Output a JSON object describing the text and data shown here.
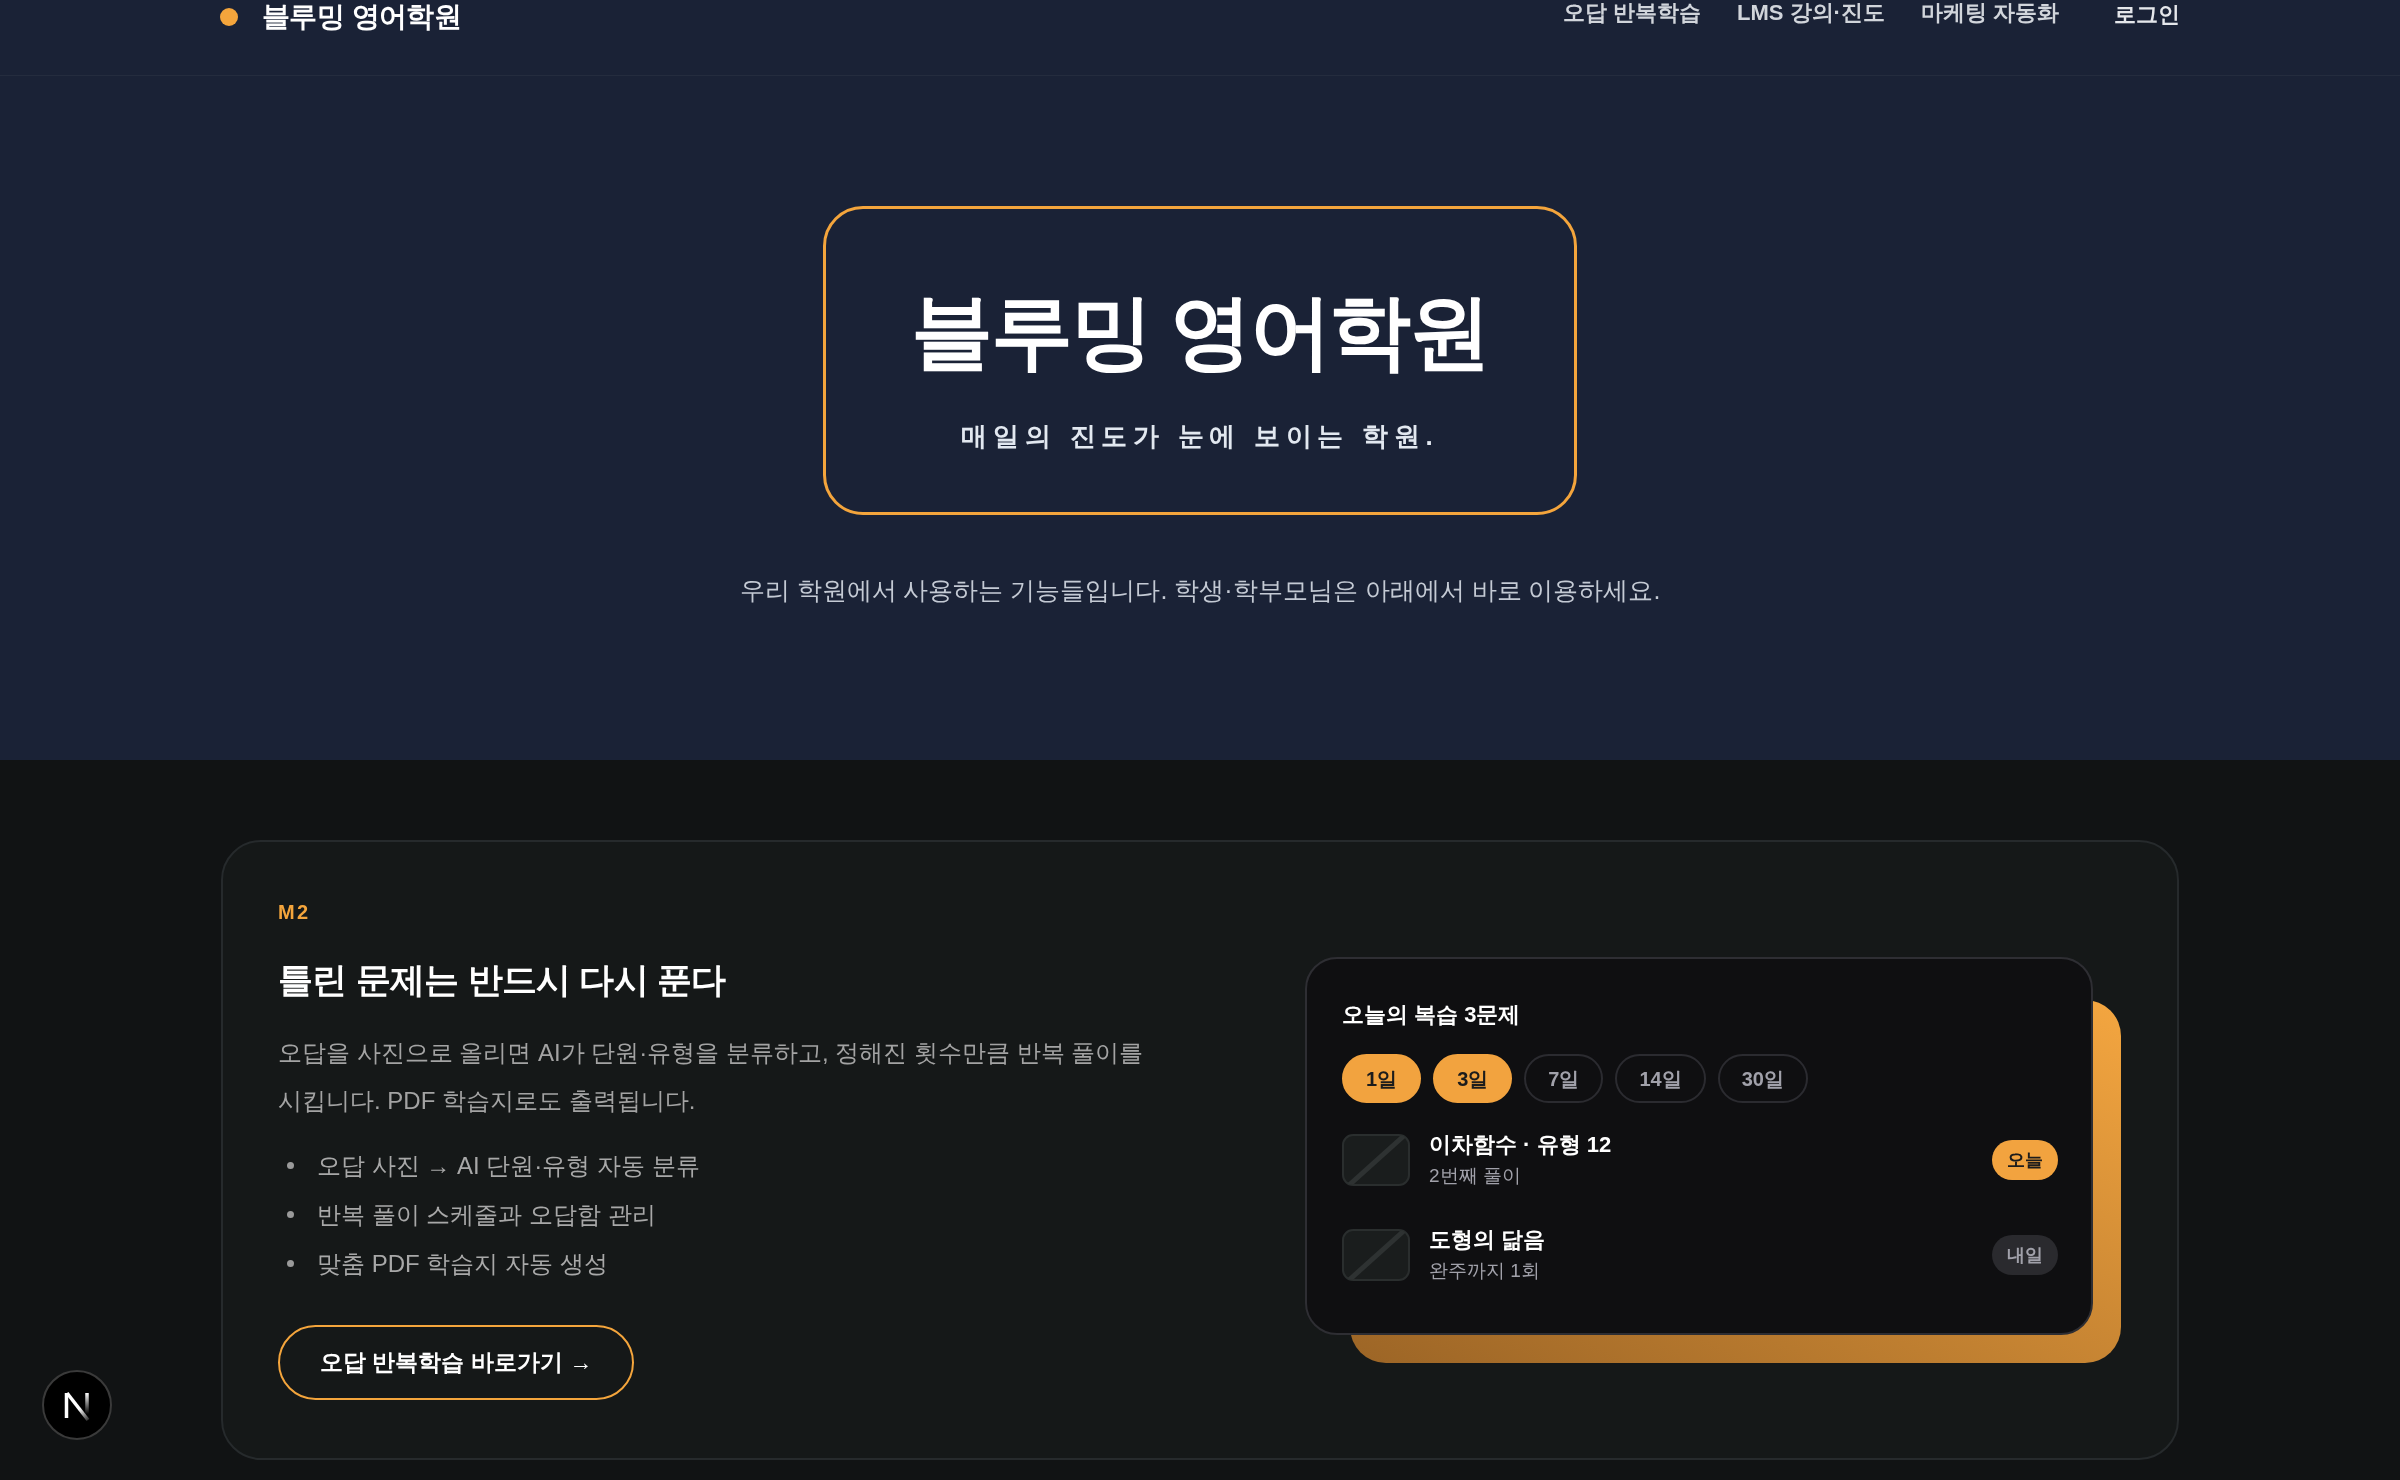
{
  "header": {
    "logo": "블루밍 영어학원",
    "nav": [
      "오답 반복학습",
      "LMS 강의·진도",
      "마케팅 자동화"
    ],
    "login": "로그인"
  },
  "hero": {
    "title": "블루밍 영어학원",
    "tagline": "매일의 진도가 눈에 보이는 학원.",
    "description": "우리 학원에서 사용하는 기능들입니다. 학생·학부모님은 아래에서 바로 이용하세요."
  },
  "feature": {
    "tag": "M2",
    "title": "틀린 문제는 반드시 다시 푼다",
    "description": "오답을 사진으로 올리면 AI가 단원·유형을 분류하고, 정해진 횟수만큼 반복 풀이를 시킵니다. PDF 학습지로도 출력됩니다.",
    "bullets": [
      "오답 사진 → AI 단원·유형 자동 분류",
      "반복 풀이 스케줄과 오답함 관리",
      "맞춤 PDF 학습지 자동 생성"
    ],
    "button": "오답 반복학습 바로가기 →",
    "review_card": {
      "title": "오늘의 복습 3문제",
      "intervals": [
        {
          "label": "1일",
          "selected": true
        },
        {
          "label": "3일",
          "selected": true
        },
        {
          "label": "7일",
          "selected": false
        },
        {
          "label": "14일",
          "selected": false
        },
        {
          "label": "30일",
          "selected": false
        }
      ],
      "items": [
        {
          "title": "이차함수 · 유형 12",
          "subtitle": "2번째 풀이",
          "badge": {
            "label": "오늘",
            "highlighted": true
          }
        },
        {
          "title": "도형의 닮음",
          "subtitle": "완주까지 1회",
          "badge": {
            "label": "내일",
            "highlighted": false
          }
        }
      ]
    }
  }
}
